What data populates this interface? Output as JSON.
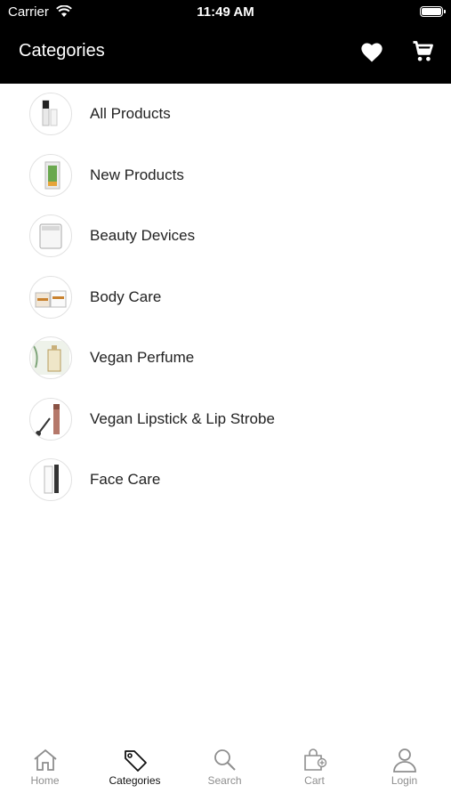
{
  "status_bar": {
    "carrier": "Carrier",
    "time": "11:49 AM"
  },
  "header": {
    "title": "Categories",
    "icons": [
      "heart-icon",
      "cart-icon"
    ]
  },
  "categories": [
    {
      "label": "All Products"
    },
    {
      "label": "New Products"
    },
    {
      "label": "Beauty Devices"
    },
    {
      "label": "Body Care"
    },
    {
      "label": "Vegan Perfume"
    },
    {
      "label": "Vegan Lipstick & Lip Strobe"
    },
    {
      "label": "Face Care"
    }
  ],
  "tabbar": {
    "items": [
      {
        "label": "Home",
        "icon": "home-icon"
      },
      {
        "label": "Categories",
        "icon": "tag-icon",
        "active": true
      },
      {
        "label": "Search",
        "icon": "search-icon"
      },
      {
        "label": "Cart",
        "icon": "bag-icon"
      },
      {
        "label": "Login",
        "icon": "user-icon"
      }
    ]
  },
  "colors": {
    "header_bg": "#000000",
    "active_tab": "#111111",
    "inactive_tab": "#8e8e8e"
  }
}
